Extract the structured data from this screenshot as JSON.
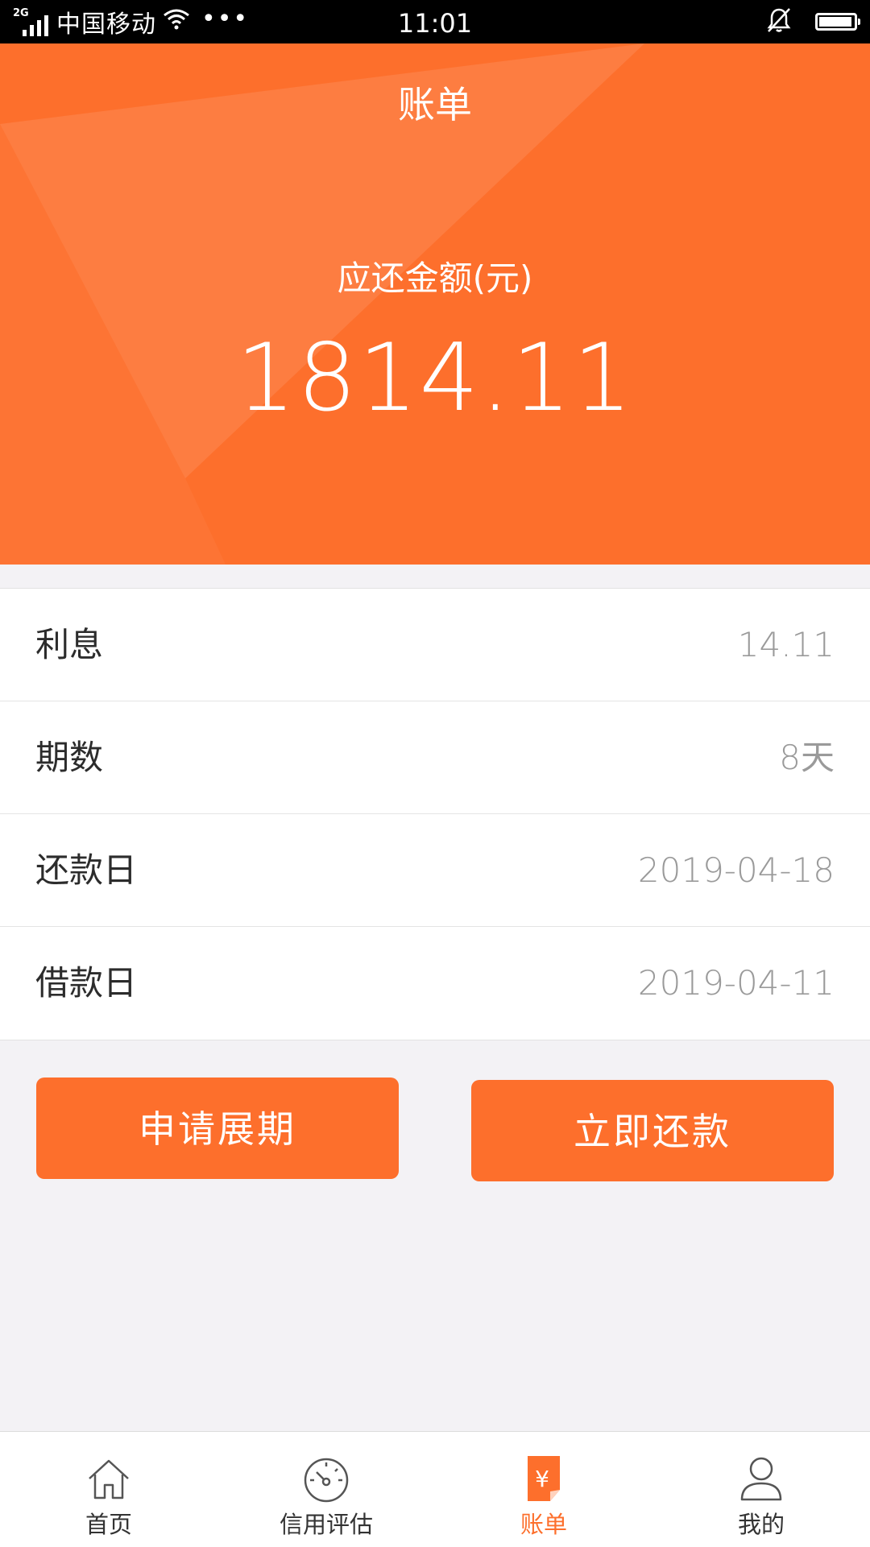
{
  "status_bar": {
    "network_type": "2G",
    "carrier": "中国移动",
    "more": "•••",
    "time": "11:01",
    "battery_level": 0.95
  },
  "header": {
    "title": "账单",
    "amount_label": "应还金额(元)",
    "amount_value": "1814.11"
  },
  "details": [
    {
      "label": "利息",
      "value": "14.11"
    },
    {
      "label": "期数",
      "value": "8天"
    },
    {
      "label": "还款日",
      "value": "2019-04-18"
    },
    {
      "label": "借款日",
      "value": "2019-04-11"
    }
  ],
  "actions": {
    "extend_label": "申请展期",
    "repay_label": "立即还款"
  },
  "tabs": [
    {
      "label": "首页",
      "icon": "home-icon",
      "active": false
    },
    {
      "label": "信用评估",
      "icon": "gauge-icon",
      "active": false
    },
    {
      "label": "账单",
      "icon": "bill-icon",
      "active": true
    },
    {
      "label": "我的",
      "icon": "user-icon",
      "active": false
    }
  ],
  "colors": {
    "accent": "#fd6f2c",
    "page_background": "#f3f2f5",
    "value_text": "#9a9a9a"
  }
}
